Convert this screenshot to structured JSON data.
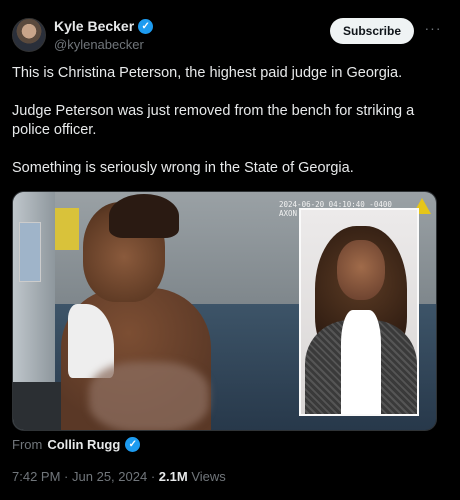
{
  "author": {
    "display_name": "Kyle Becker",
    "handle": "@kylenabecker",
    "verified_glyph": "✓"
  },
  "actions": {
    "subscribe_label": "Subscribe",
    "more_label": "···"
  },
  "tweet": {
    "paragraphs": [
      "This is Christina Peterson, the highest paid judge in Georgia.",
      "Judge Peterson was just removed from the bench for striking a police officer.",
      "Something is seriously wrong in the State of Georgia."
    ]
  },
  "media": {
    "timestamp_overlay_line1": "2024-06-20 04:10:40 -0400",
    "timestamp_overlay_line2": "AXON",
    "warning_icon": "warning-triangle-icon"
  },
  "source": {
    "prefix": "From",
    "name": "Collin Rugg",
    "verified_glyph": "✓"
  },
  "meta": {
    "time": "7:42 PM",
    "date": "Jun 25, 2024",
    "separator": "·",
    "views_count": "2.1M",
    "views_label": "Views"
  },
  "colors": {
    "background": "#000000",
    "text": "#e7e9ea",
    "muted": "#71767b",
    "verified_blue": "#1d9bf0",
    "subscribe_bg": "#eff3f4"
  }
}
